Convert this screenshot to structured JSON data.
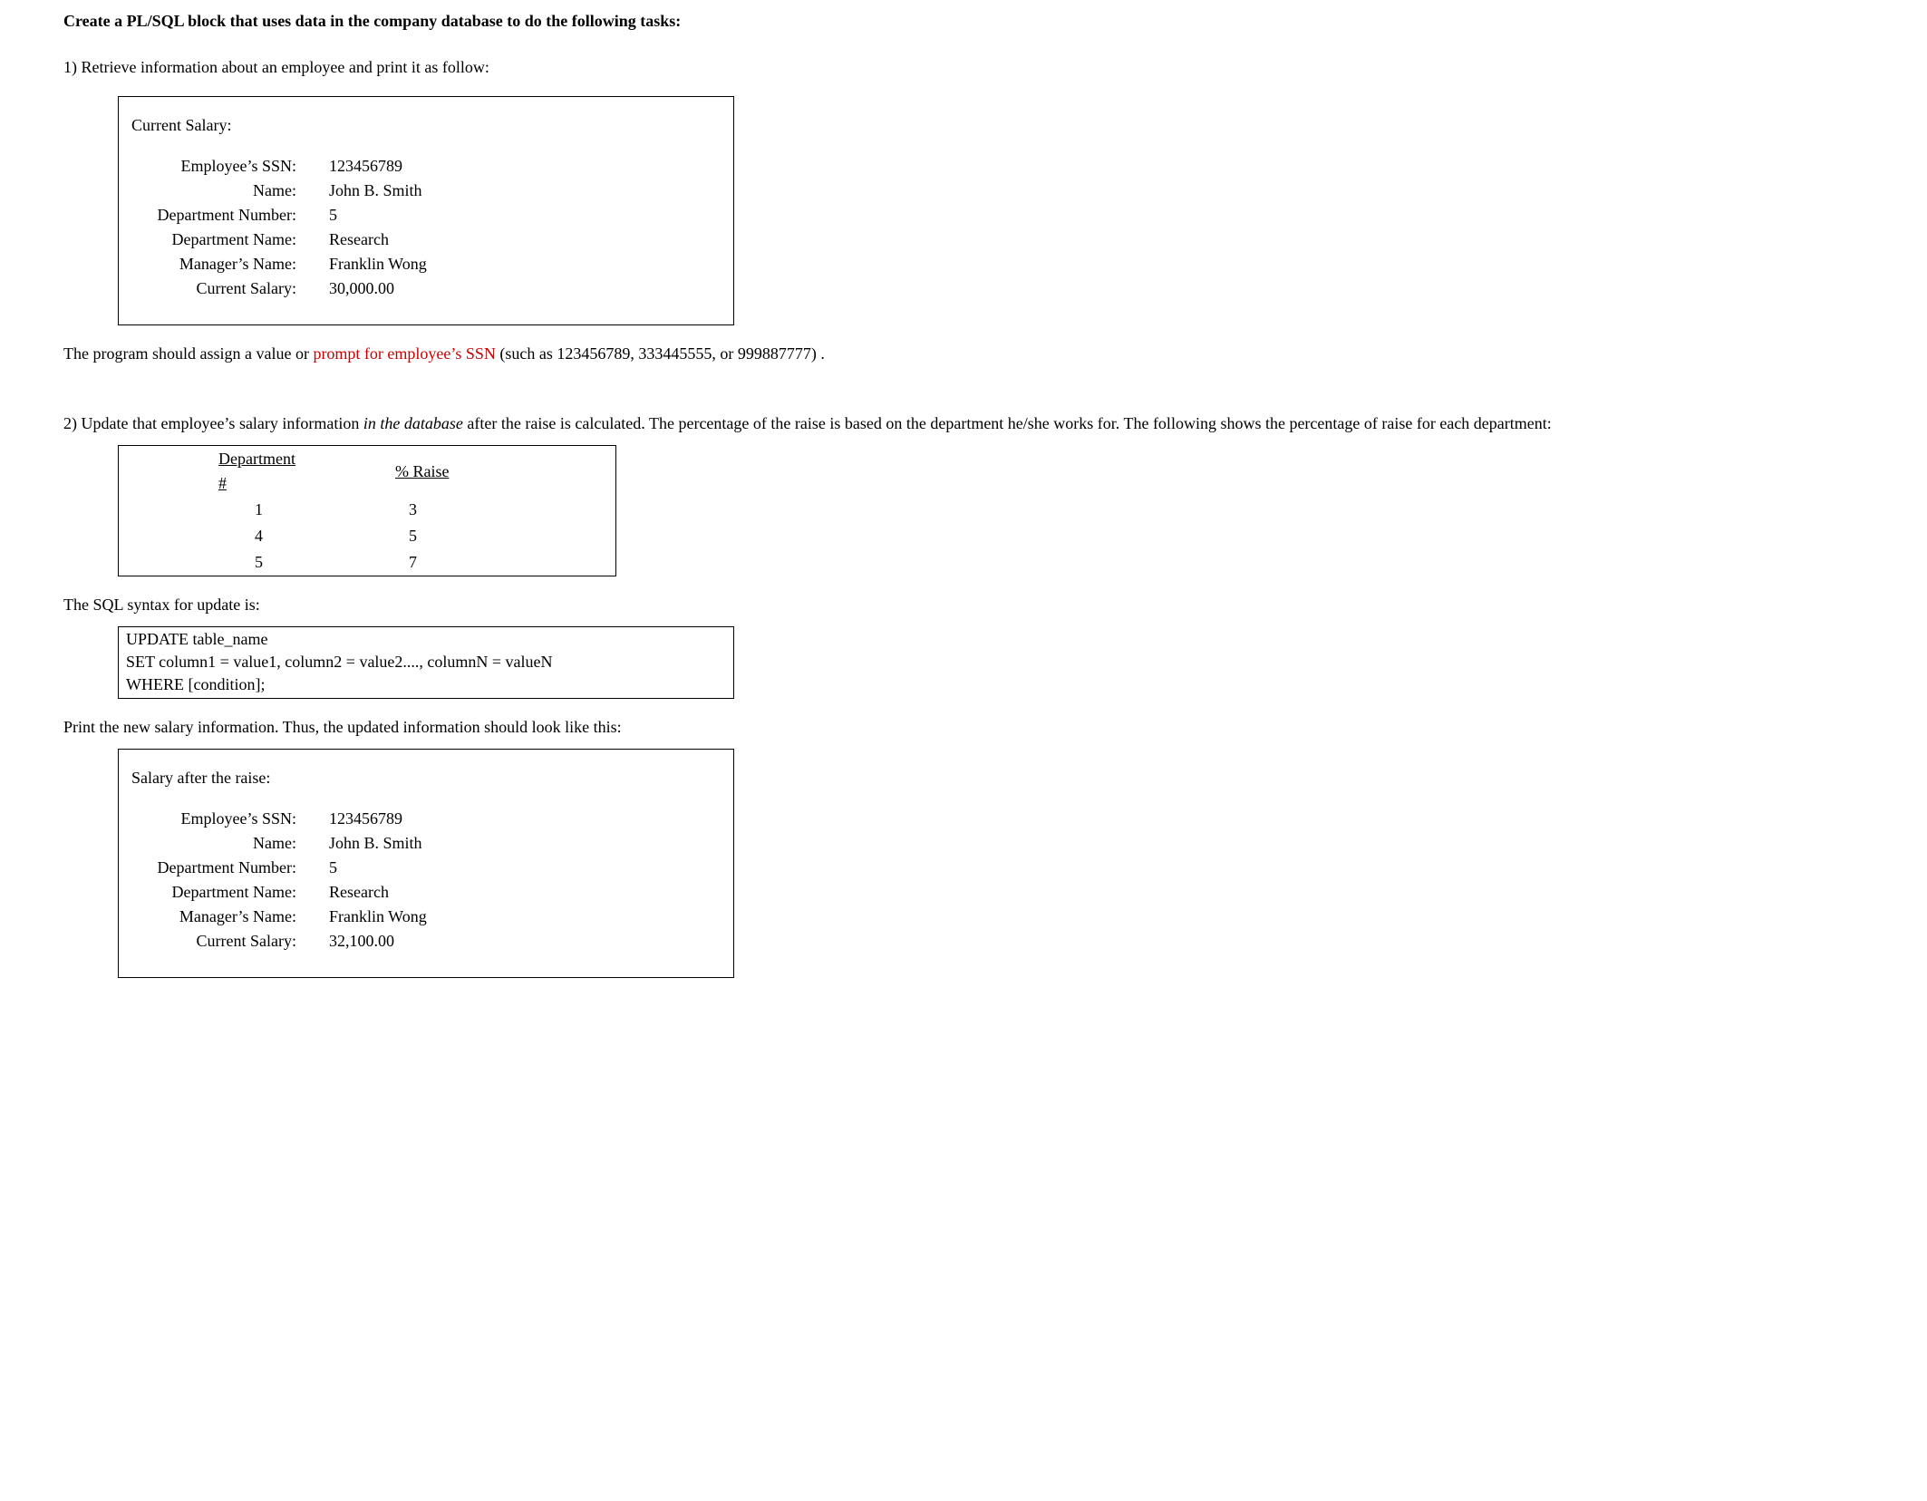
{
  "title": "Create a PL/SQL block that uses data in the company database to do the following tasks:",
  "task1": "1) Retrieve information about an employee and print it as follow:",
  "box1_title": "Current Salary:",
  "rows": {
    "ssn": {
      "label": "Employee’s SSN:",
      "value": "123456789"
    },
    "name": {
      "label": "Name:",
      "value": "John B.  Smith"
    },
    "dnum": {
      "label": "Department Number:",
      "value": "5"
    },
    "dname": {
      "label": "Department Name:",
      "value": "Research"
    },
    "mgr": {
      "label": "Manager’s Name:",
      "value": "Franklin Wong"
    },
    "sal1": {
      "label": "Current Salary:",
      "value": "30,000.00"
    },
    "sal2": {
      "label": "Current Salary:",
      "value": "32,100.00"
    }
  },
  "prompt_line_pre": "The program should assign a value or ",
  "prompt_red": "prompt for employee’s SSN",
  "prompt_line_post": " (such as 123456789, 333445555, or 999887777) .",
  "task2_pre": "2) Update that employee’s salary information ",
  "task2_italic": "in the database",
  "task2_post": " after the raise is calculated.  The percentage of the raise is based on the department he/she works for.  The following shows the percentage of raise for each department:",
  "raise_table": {
    "header1": "Department #",
    "header2": "% Raise",
    "rows": [
      {
        "dept": "1",
        "raise": "3"
      },
      {
        "dept": "4",
        "raise": "5"
      },
      {
        "dept": "5",
        "raise": "7"
      }
    ]
  },
  "sql_intro": "The SQL syntax for update is:",
  "sql_box": {
    "l1": "UPDATE table_name",
    "l2": "SET column1 = value1, column2 = value2...., columnN = valueN",
    "l3": "WHERE [condition];"
  },
  "print_new": "Print the new salary information.  Thus, the updated information should look like this:",
  "box2_title": "Salary after the raise:"
}
